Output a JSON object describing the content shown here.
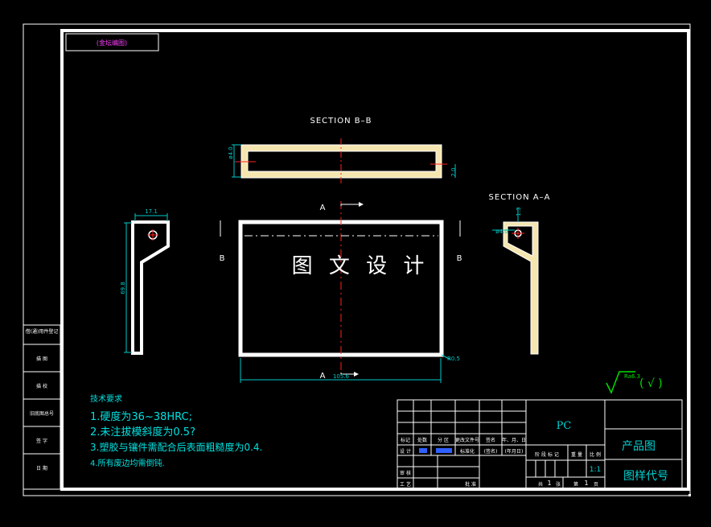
{
  "colors": {
    "background": "#000000",
    "frame": "#ffffff",
    "part_outline": "#ffffff",
    "part_fill": "#f5e6b0",
    "center_line": "#ff2020",
    "dimension": "#00c8c8",
    "notes_text": "#00e0e0",
    "tb_label": "#ff40ff",
    "tb_blue": "#3060ff",
    "pc_text": "#00d0d0",
    "check": "#00e000"
  },
  "drawing": {
    "corner_label": "(金坛编图)",
    "watermark": "图 文 设 计",
    "section_bb": "SECTION B–B",
    "section_aa": "SECTION A–A",
    "mark_a_top": "A",
    "mark_a_bottom": "A",
    "mark_b_left": "B",
    "mark_b_right": "B",
    "dims": {
      "bb_left": "ø4.0",
      "bb_right": "2.0",
      "left_top": "17.1",
      "left_height": "69.8",
      "main_width": "105.6",
      "main_corner": "R0.5",
      "aa_top": "1.3",
      "aa_left": "ø4.0"
    },
    "roughness": "Ra6.3",
    "roughness_paren": "( √ )"
  },
  "notes": {
    "heading": "技术要求",
    "items": [
      "1.硬度为36~38HRC;",
      "2.未注拔模斜度为0.5?",
      "3.塑胶与镶件需配合后表面粗糙度为0.4.",
      "4.所有废边均需倒钝."
    ]
  },
  "side_table": [
    "借(通)用件登记",
    "描 图",
    "描 校",
    "旧底图总号",
    "签 字",
    "日 期"
  ],
  "title_block": {
    "headers": [
      "标记",
      "处数",
      "分 区",
      "更改文件号",
      "签名",
      "年、月、日"
    ],
    "design_row": [
      "设 计",
      "",
      "",
      "标准化",
      "(签名)",
      "(年月日)"
    ],
    "review": "审 核",
    "process": "工 艺",
    "approve": "批 准",
    "stage_labels": [
      "阶 段 标 记",
      "重 量",
      "比 例"
    ],
    "material": "PC",
    "scale": "1:1",
    "sheet_total_label": "共",
    "sheet_total": "1",
    "sheet_no_label": "张",
    "sheet_no_prefix": "第",
    "sheet_no": "1",
    "sheet_unit": "页",
    "product_name": "产品图",
    "drawing_code": "图样代号"
  }
}
